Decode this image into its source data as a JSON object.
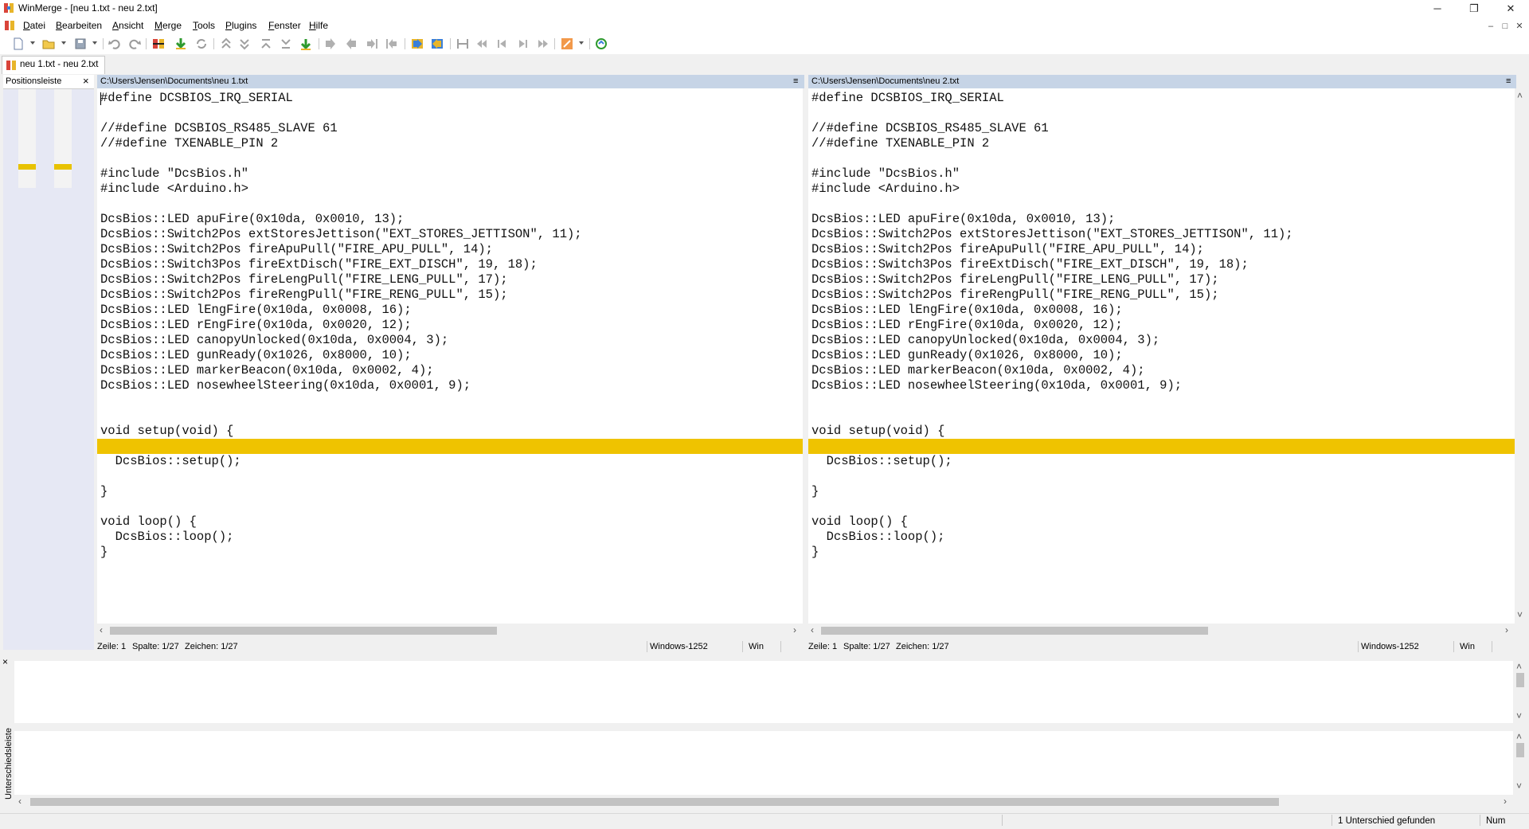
{
  "window": {
    "title": "WinMerge - [neu 1.txt - neu 2.txt]",
    "minimize": "─",
    "restore": "❐",
    "close": "✕"
  },
  "menu": {
    "items": [
      "Datei",
      "Bearbeiten",
      "Ansicht",
      "Merge",
      "Tools",
      "Plugins",
      "Fenster",
      "Hilfe"
    ],
    "mdi_min": "–",
    "mdi_restore": "□",
    "mdi_close": "✕"
  },
  "doc_tab": {
    "label": "neu 1.txt - neu 2.txt"
  },
  "location_pane": {
    "title": "Positionsleiste",
    "close": "×"
  },
  "left": {
    "path": "C:\\Users\\Jensen\\Documents\\neu 1.txt",
    "status": {
      "line": "Zeile: 1",
      "col": "Spalte: 1/27",
      "chars": "Zeichen: 1/27",
      "encoding": "Windows-1252",
      "eol": "Win"
    }
  },
  "right": {
    "path": "C:\\Users\\Jensen\\Documents\\neu 2.txt",
    "status": {
      "line": "Zeile: 1",
      "col": "Spalte: 1/27",
      "chars": "Zeichen: 1/27",
      "encoding": "Windows-1252",
      "eol": "Win"
    }
  },
  "code_lines": [
    "#define DCSBIOS_IRQ_SERIAL",
    "",
    "//#define DCSBIOS_RS485_SLAVE 61",
    "//#define TXENABLE_PIN 2",
    "",
    "#include \"DcsBios.h\"",
    "#include <Arduino.h>",
    "",
    "DcsBios::LED apuFire(0x10da, 0x0010, 13);",
    "DcsBios::Switch2Pos extStoresJettison(\"EXT_STORES_JETTISON\", 11);",
    "DcsBios::Switch2Pos fireApuPull(\"FIRE_APU_PULL\", 14);",
    "DcsBios::Switch3Pos fireExtDisch(\"FIRE_EXT_DISCH\", 19, 18);",
    "DcsBios::Switch2Pos fireLengPull(\"FIRE_LENG_PULL\", 17);",
    "DcsBios::Switch2Pos fireRengPull(\"FIRE_RENG_PULL\", 15);",
    "DcsBios::LED lEngFire(0x10da, 0x0008, 16);",
    "DcsBios::LED rEngFire(0x10da, 0x0020, 12);",
    "DcsBios::LED canopyUnlocked(0x10da, 0x0004, 3);",
    "DcsBios::LED gunReady(0x1026, 0x8000, 10);",
    "DcsBios::LED markerBeacon(0x10da, 0x0002, 4);",
    "DcsBios::LED nosewheelSteering(0x10da, 0x0001, 9);",
    "",
    "",
    "void setup(void) {",
    "",
    "  DcsBios::setup();",
    "",
    "}",
    "",
    "void loop() {",
    "  DcsBios::loop();",
    "}"
  ],
  "bottom": {
    "diff_pane_title": "Unterschiedsleiste",
    "diff_pane_close": "×",
    "status_text": "1 Unterschied gefunden",
    "num": "Num"
  },
  "colors": {
    "diff_highlight": "#efc300",
    "path_header": "#c6d4e6",
    "location_bg": "#e6e8f4"
  }
}
